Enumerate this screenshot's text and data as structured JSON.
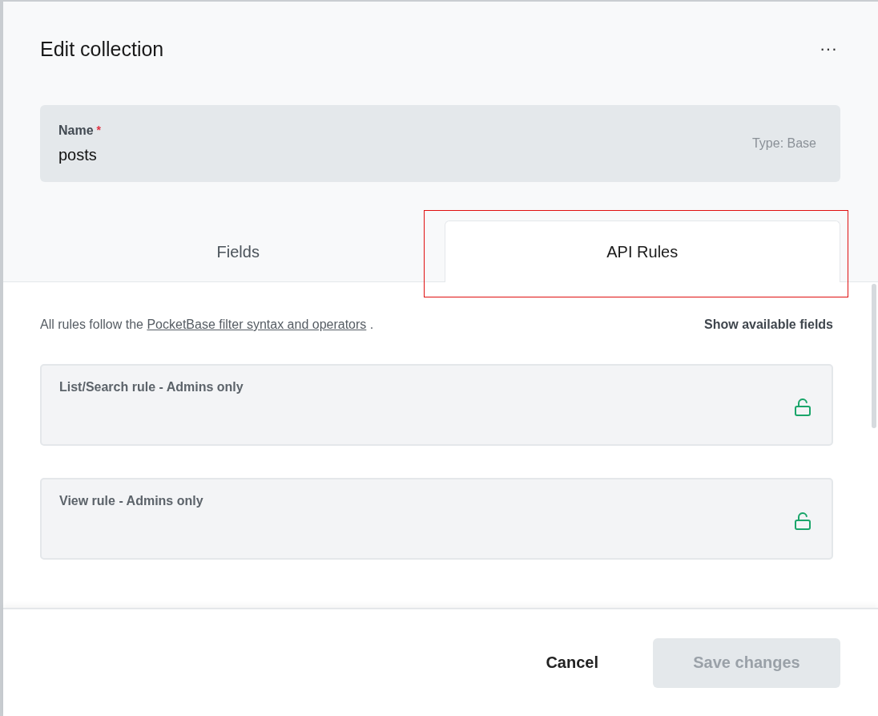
{
  "panel": {
    "title": "Edit collection",
    "menu_label": "···"
  },
  "name_field": {
    "label": "Name",
    "required_mark": "*",
    "value": "posts",
    "type_label": "Type: Base"
  },
  "tabs": [
    {
      "label": "Fields",
      "selected": false
    },
    {
      "label": "API Rules",
      "selected": true
    }
  ],
  "intro": {
    "prefix": "All rules follow the",
    "link": "PocketBase filter syntax and operators",
    "suffix": ".",
    "action": "Show available fields"
  },
  "rules": [
    {
      "label": "List/Search rule - Admins only",
      "locked": false
    },
    {
      "label": "View rule - Admins only",
      "locked": false
    }
  ],
  "footer": {
    "cancel": "Cancel",
    "save": {
      "label": "Save changes",
      "disabled": true
    }
  }
}
